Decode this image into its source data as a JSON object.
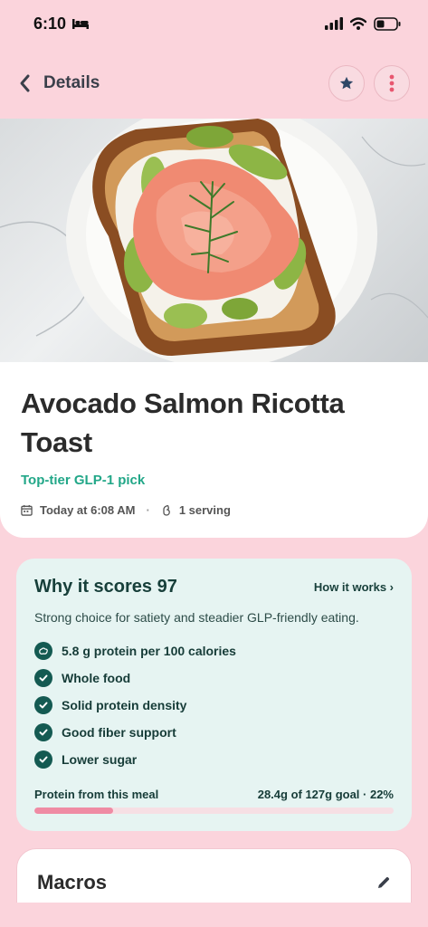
{
  "status_bar": {
    "time": "6:10"
  },
  "header": {
    "back_label": "Details"
  },
  "recipe": {
    "title": "Avocado Salmon Ricotta Toast",
    "tag": "Top-tier GLP-1 pick",
    "logged_time": "Today at 6:08 AM",
    "servings": "1 serving"
  },
  "score": {
    "title": "Why it scores 97",
    "how_link": "How it works ›",
    "description": "Strong choice for satiety and steadier GLP-friendly eating.",
    "checks": [
      {
        "label": "5.8 g protein per 100 calories",
        "icon": "protein-icon"
      },
      {
        "label": "Whole food",
        "icon": "check-icon"
      },
      {
        "label": "Solid protein density",
        "icon": "check-icon"
      },
      {
        "label": "Good fiber support",
        "icon": "check-icon"
      },
      {
        "label": "Lower sugar",
        "icon": "check-icon"
      }
    ],
    "protein_label": "Protein from this meal",
    "protein_value": "28.4g of 127g goal · 22%",
    "protein_progress": 0.22
  },
  "macros": {
    "title": "Macros"
  },
  "colors": {
    "background": "#fbd4dc",
    "accent_green": "#22a788",
    "dark_teal": "#145a52",
    "progress_pink": "#ef8ba4"
  }
}
